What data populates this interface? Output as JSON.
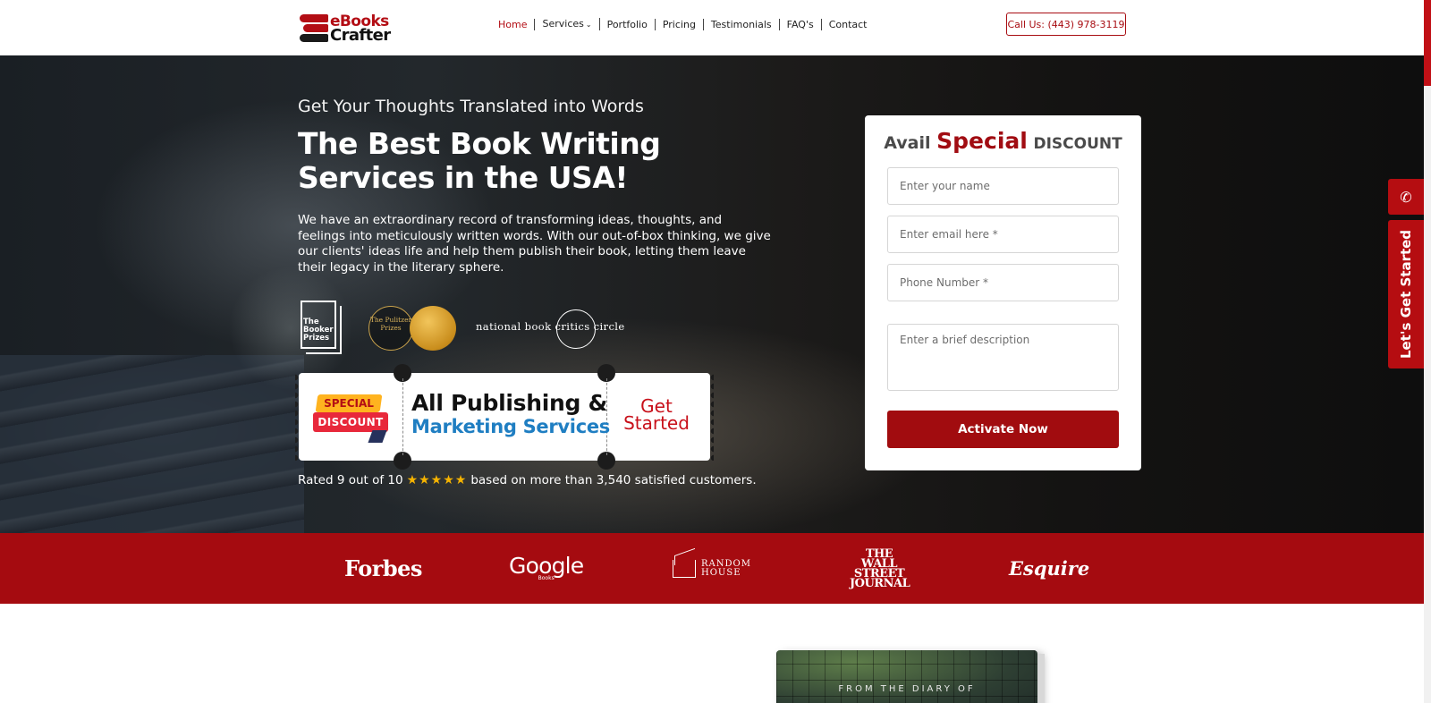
{
  "header": {
    "logo_line1": "eBooks",
    "logo_line2": "Crafter",
    "nav": [
      "Home",
      "Services",
      "Portfolio",
      "Pricing",
      "Testimonials",
      "FAQ's",
      "Contact"
    ],
    "call_button": "Call Us: (443) 978-3119"
  },
  "hero": {
    "kicker": "Get Your Thoughts Translated into Words",
    "title": "The Best Book Writing Services in the USA!",
    "description": "We have an extraordinary record of transforming ideas, thoughts, and feelings into meticulously written words. With our out-of-box thinking, we give our clients' ideas life and help them publish their book, letting them leave their legacy in the literary sphere.",
    "awards": {
      "booker": "The Booker Prizes",
      "pulitzer": "The Pulitzer Prizes",
      "nbcc": "national book critics circle"
    },
    "ticket": {
      "badge_top": "SPECIAL",
      "badge_bottom": "DISCOUNT",
      "line1": "All Publishing &",
      "line2": "Marketing Services",
      "cta": "Get Started"
    },
    "rating": {
      "prefix": "Rated 9 out of 10",
      "stars": "★★★★★",
      "star_count": 5,
      "suffix": "based on more than 3,540 satisfied customers."
    }
  },
  "form": {
    "title_pre": "Avail",
    "title_special": "Special",
    "title_post": "DISCOUNT",
    "name_placeholder": "Enter your name",
    "email_placeholder": "Enter email here *",
    "phone_placeholder": "Phone Number *",
    "description_placeholder": "Enter a brief description",
    "submit": "Activate Now"
  },
  "side": {
    "phone_icon": "phone-icon",
    "started_label": "Let's Get Started"
  },
  "press": {
    "logos": [
      "Forbes",
      "Google",
      "Books",
      "RANDOM HOUSE",
      "THE WALL STREET JOURNAL",
      "Esquire"
    ]
  },
  "below": {
    "book_text": "FROM THE DIARY OF"
  },
  "colors": {
    "brand_red": "#a50b10",
    "accent_blue": "#1f7ec2",
    "star_gold": "#f5b301"
  }
}
